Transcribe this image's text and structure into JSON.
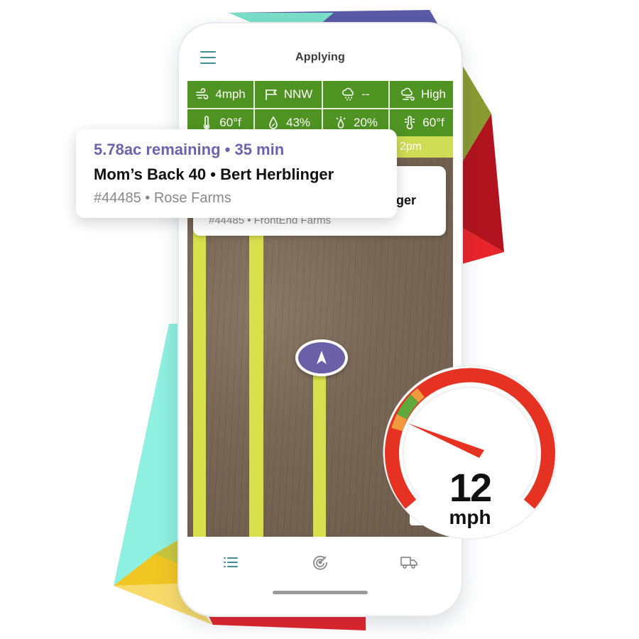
{
  "app": {
    "title": "Applying"
  },
  "weather": {
    "row1": [
      {
        "icon": "wind-icon",
        "value": "4mph"
      },
      {
        "icon": "wind-direction-flag-icon",
        "value": "NNW"
      },
      {
        "icon": "rain-cloud-icon",
        "value": "--"
      },
      {
        "icon": "drift-risk-icon",
        "value": "High"
      }
    ],
    "row2": [
      {
        "icon": "thermometer-icon",
        "value": "60°f"
      },
      {
        "icon": "humidity-drop-icon",
        "value": "43%"
      },
      {
        "icon": "precipitation-chance-icon",
        "value": "20%"
      },
      {
        "icon": "dew-point-icon",
        "value": "60°f"
      }
    ]
  },
  "time_strip": {
    "text": "2pm"
  },
  "back_card": {
    "title_fragment": "nger",
    "subtitle": "#44485 • FrontEnd Farms"
  },
  "job_card": {
    "remaining": "5.78ac remaining • 35 min",
    "title": "Mom’s Back 40 • Bert Herblinger",
    "subtitle": "#44485 • Rose Farms"
  },
  "speedometer": {
    "value": "12",
    "unit": "mph"
  },
  "bottom_nav": [
    {
      "icon": "list-icon",
      "active": true
    },
    {
      "icon": "target-icon",
      "active": false
    },
    {
      "icon": "truck-icon",
      "active": false
    }
  ],
  "colors": {
    "weather_green": "#4f9423",
    "strip_yellow": "#cfdc55",
    "path_yellow": "#d7df4b",
    "accent_purple": "#6e62ad",
    "gauge_red": "#e53223",
    "gauge_green": "#5fa83a",
    "gauge_orange": "#f19a3e",
    "nav_teal": "#3f8f93"
  }
}
